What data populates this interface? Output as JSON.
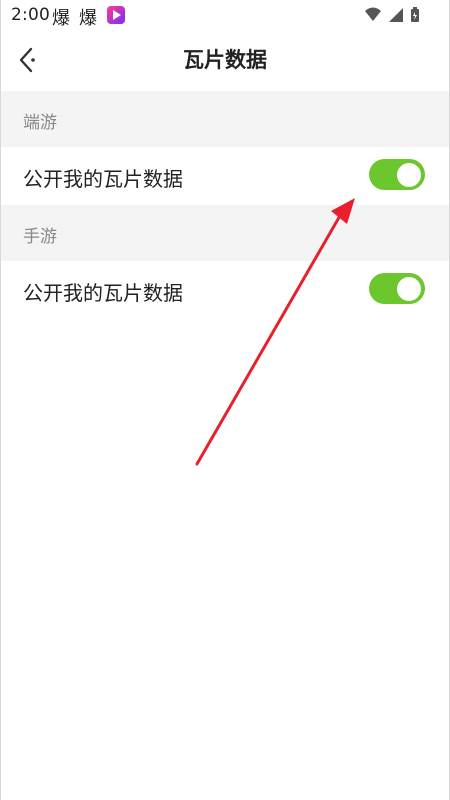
{
  "status_bar": {
    "time": "2:00",
    "notif_1": "爆",
    "notif_2": "爆",
    "icons": [
      "wifi-icon",
      "signal-icon",
      "battery-icon"
    ]
  },
  "header": {
    "back_icon": "chevron-left-icon",
    "title": "瓦片数据"
  },
  "sections": [
    {
      "title": "端游",
      "rows": [
        {
          "label": "公开我的瓦片数据",
          "toggle_on": true
        }
      ]
    },
    {
      "title": "手游",
      "rows": [
        {
          "label": "公开我的瓦片数据",
          "toggle_on": true
        }
      ]
    }
  ],
  "colors": {
    "toggle_on": "#6cc72e",
    "section_bg": "#f4f4f5",
    "annotation_arrow": "#e8202d"
  }
}
